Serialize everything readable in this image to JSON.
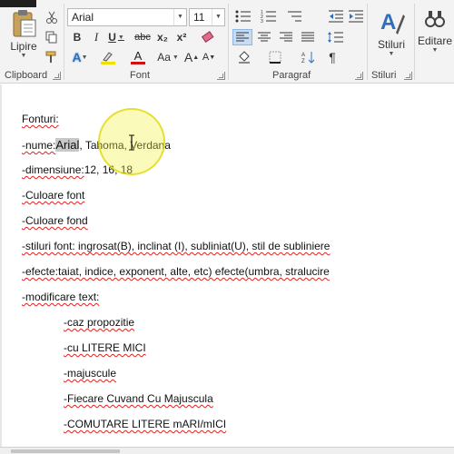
{
  "ribbon": {
    "clipboard": {
      "paste_label": "Lipire",
      "group_label": "Clipboard"
    },
    "font": {
      "font_name": "Arial",
      "font_size": "11",
      "group_label": "Font",
      "bold": "B",
      "italic": "I",
      "underline": "U",
      "strike": "abc",
      "subscript": "x₂",
      "superscript": "x²",
      "change_case": "Aa",
      "grow": "A",
      "shrink": "A",
      "font_color": "A",
      "highlight_color": "#f0e000",
      "font_color_value": "#d01010"
    },
    "paragraph": {
      "group_label": "Paragraf",
      "pilcrow": "¶"
    },
    "styles": {
      "label": "Stiluri",
      "group_label": "Stiluri"
    },
    "editing": {
      "label": "Editare"
    }
  },
  "document": {
    "lines": [
      {
        "text": "Fonturi:"
      },
      {
        "prefix": "-nume:",
        "highlighted": "Arial",
        "rest_a": ", Tahoma",
        "rest_b": ", Verdana"
      },
      {
        "prefix": "-dimensiune:",
        "rest": "12, 16, 18"
      },
      {
        "text": "-Culoare font"
      },
      {
        "text": "-Culoare fond"
      },
      {
        "text": "-stiluri font: ingrosat(B), inclinat (I), subliniat(U), stil de subliniere"
      },
      {
        "text": "-efecte:taiat, indice, exponent, alte, etc) efecte(umbra, stralucire"
      },
      {
        "text": "-modificare text:"
      },
      {
        "text": "-caz propozitie"
      },
      {
        "text": "-cu LITERE MICI"
      },
      {
        "text": "-majuscule"
      },
      {
        "text": "-Fiecare Cuvand Cu Majuscula"
      },
      {
        "text": "-COMUTARE LITERE mARI/mICI"
      }
    ]
  }
}
